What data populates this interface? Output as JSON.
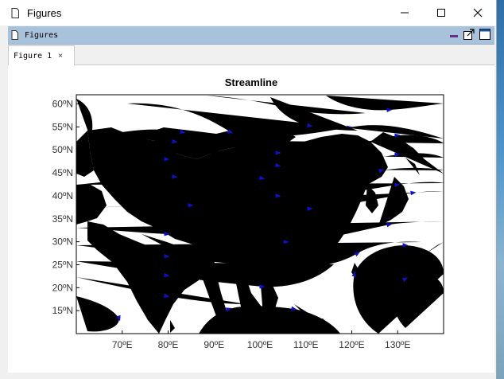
{
  "window": {
    "title": "Figures",
    "controls": [
      "minimize",
      "maximize",
      "close"
    ]
  },
  "panel": {
    "title": "Figures",
    "tools": [
      "minimize-icon",
      "undock-icon",
      "maximize-icon"
    ]
  },
  "tabs": [
    {
      "label": "Figure 1",
      "close": "×"
    }
  ],
  "chart_data": {
    "type": "streamline",
    "title": "Streamline",
    "x_ticks": [
      "70ºE",
      "80ºE",
      "90ºE",
      "100ºE",
      "110ºE",
      "120ºE",
      "130ºE"
    ],
    "y_ticks": [
      "15ºN",
      "20ºN",
      "25ºN",
      "30ºN",
      "35ºN",
      "40ºN",
      "45ºN",
      "50ºN",
      "55ºN",
      "60ºN"
    ],
    "x_values": [
      70,
      80,
      90,
      100,
      110,
      120,
      130
    ],
    "y_values": [
      15,
      20,
      25,
      30,
      35,
      40,
      45,
      50,
      55,
      60
    ],
    "xlim": [
      60,
      140
    ],
    "ylim": [
      10,
      62
    ],
    "stream_color": "#1010c8",
    "map_color": "#000000",
    "grid": false
  }
}
